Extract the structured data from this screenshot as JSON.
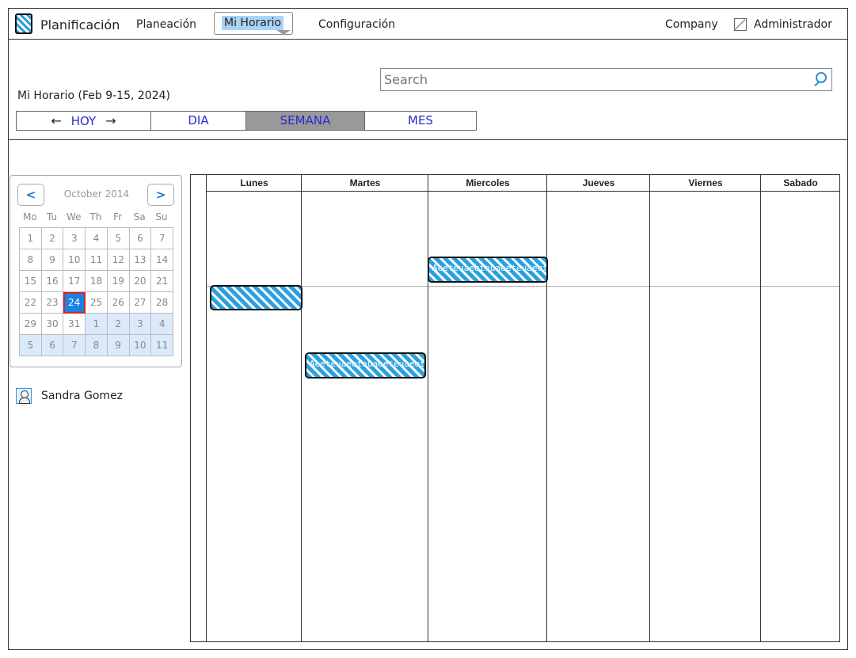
{
  "header": {
    "brand": "Planificación",
    "nav": [
      "Planeación",
      "Mi Horario",
      "Configuración"
    ],
    "company": "Company",
    "admin": "Administrador"
  },
  "search": {
    "placeholder": "Search"
  },
  "page": {
    "subtitle": "Mi Horario (Feb 9-15, 2024)"
  },
  "view_tabs": {
    "today": "HOY",
    "prev_arrow": "←",
    "next_arrow": "→",
    "day": "DIA",
    "week": "SEMANA",
    "month": "MES",
    "active": "SEMANA"
  },
  "mini_calendar": {
    "prev": "<",
    "next": ">",
    "month_label": "October 2014",
    "weekdays": [
      "Mo",
      "Tu",
      "We",
      "Th",
      "Fr",
      "Sa",
      "Su"
    ],
    "days": [
      [
        "1",
        "2",
        "3",
        "4",
        "5",
        "6",
        "7"
      ],
      [
        "8",
        "9",
        "10",
        "11",
        "12",
        "13",
        "14"
      ],
      [
        "15",
        "16",
        "17",
        "18",
        "19",
        "20",
        "21"
      ],
      [
        "22",
        "23",
        "24",
        "25",
        "26",
        "27",
        "28"
      ],
      [
        "29",
        "30",
        "31",
        "1",
        "2",
        "3",
        "4"
      ],
      [
        "5",
        "6",
        "7",
        "8",
        "9",
        "10",
        "11"
      ]
    ],
    "selected": "24"
  },
  "user": {
    "name": "Sandra Gomez"
  },
  "week": {
    "days": [
      "Lunes",
      "Martes",
      "Miercoles",
      "Jueves",
      "Viernes",
      "Sabado"
    ],
    "events": [
      {
        "day": "Lunes",
        "label": ""
      },
      {
        "day": "Martes",
        "label": "Aeeteuaeeteuaeeteuaeeteu"
      },
      {
        "day": "Miercoles",
        "label": "Aeeteuaeeteuaeeteuaeeteu"
      }
    ]
  },
  "colors": {
    "accent": "#2aa0e0",
    "tab_active": "#999999",
    "today": "#1a82e0"
  }
}
